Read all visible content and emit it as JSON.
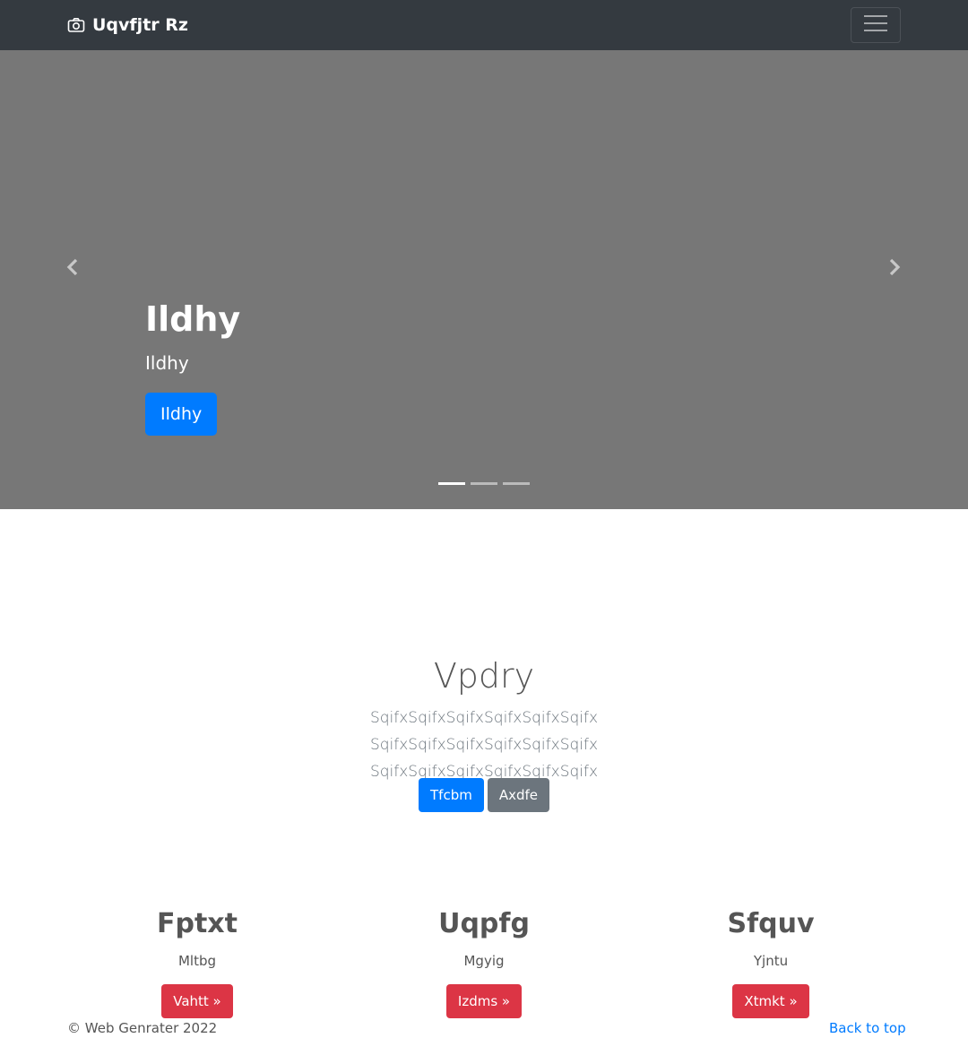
{
  "navbar": {
    "brand": "Uqvfjtr Rz",
    "brand_icon": "camera-icon",
    "toggler_icon": "hamburger-menu-icon",
    "background": "#343a40"
  },
  "carousel": {
    "background": "#777777",
    "caption": {
      "heading": "Ildhy",
      "text": "Ildhy",
      "button_label": "Ildhy"
    },
    "prev_icon": "chevron-left-icon",
    "next_icon": "chevron-right-icon",
    "slide_count": 3,
    "active_slide": 1
  },
  "jumbotron": {
    "title": "Vpdry",
    "lead": "SqifxSqifxSqifxSqifxSqifxSqifx SqifxSqifxSqifxSqifxSqifxSqifx SqifxSqifxSqifxSqifxSqifxSqifx",
    "primary_button": "Tfcbm",
    "secondary_button": "Axdfe"
  },
  "features": [
    {
      "title": "Fptxt",
      "text": "Mltbg",
      "button": "Vahtt »"
    },
    {
      "title": "Uqpfg",
      "text": "Mgyig",
      "button": "Izdms »"
    },
    {
      "title": "Sfquv",
      "text": "Yjntu",
      "button": "Xtmkt »"
    }
  ],
  "footer": {
    "copyright": "© Web Genrater 2022",
    "back_to_top": "Back to top"
  },
  "colors": {
    "primary": "#007bff",
    "secondary": "#6c757d",
    "danger": "#dc3545"
  }
}
